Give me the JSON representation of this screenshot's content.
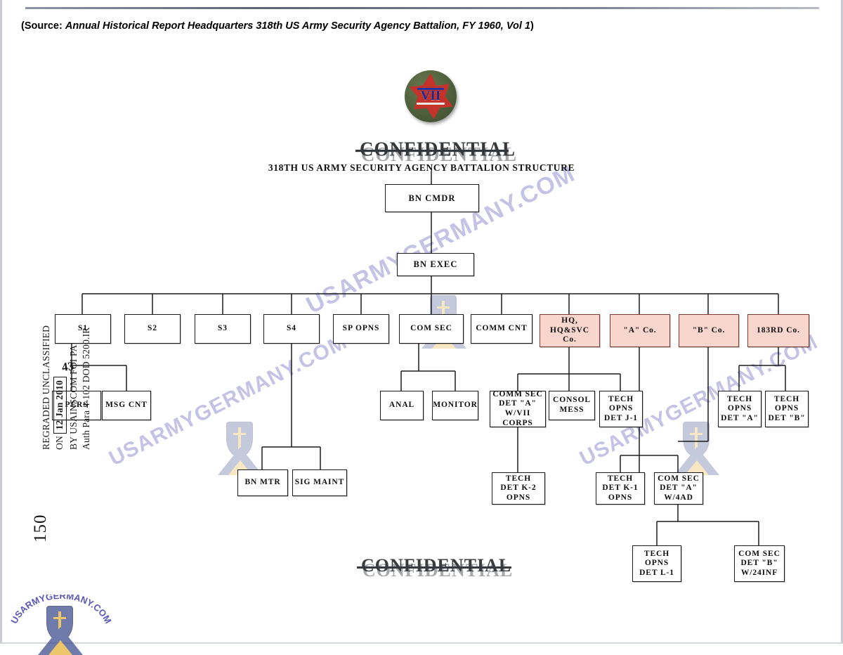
{
  "document": {
    "source_line_prefix": "(Source: ",
    "source_line_italic": "Annual Historical Report Headquarters 318th US Army Security Agency Battalion, FY 1960, Vol 1",
    "source_line_suffix": ")",
    "page_number": "150",
    "chart_title": "318TH US ARMY SECURITY AGENCY BATTALION STRUCTURE",
    "classification_top": "CONFIDENTIAL",
    "classification_bottom": "CONFIDENTIAL",
    "handwritten_note": "43"
  },
  "insignia": {
    "name": "vii-corps-patch",
    "numerals": "VII",
    "star_color": "#c4322c",
    "field_color": "#4e5f3c",
    "numeral_color": "#1a2a8c"
  },
  "declassification_stamp": {
    "line1": "REGRADED UNCLASSIFIED",
    "line2_label": "ON",
    "line2_date": "12 Jan 2010",
    "line3": "BY USAINSCOM FOI PA",
    "line4": "Auth Para 4-102 DOD 5200.IR"
  },
  "watermarks": {
    "text": "USARMYGERMANY.COM",
    "color": "#6c68be"
  },
  "chart_data": {
    "type": "diagram",
    "title": "318TH US ARMY SECURITY AGENCY BATTALION STRUCTURE",
    "diagram_kind": "organizational-chart",
    "highlight_color": "#f8d5cd",
    "nodes": [
      {
        "id": "bn_cmdr",
        "label": "BN  CMDR",
        "tier": 0,
        "highlight": false
      },
      {
        "id": "bn_exec",
        "label": "BN  EXEC",
        "tier": 1,
        "highlight": false
      },
      {
        "id": "s1",
        "label": "S1",
        "tier": 2,
        "highlight": false
      },
      {
        "id": "s2",
        "label": "S2",
        "tier": 2,
        "highlight": false
      },
      {
        "id": "s3",
        "label": "S3",
        "tier": 2,
        "highlight": false
      },
      {
        "id": "s4",
        "label": "S4",
        "tier": 2,
        "highlight": false
      },
      {
        "id": "sp_opns",
        "label": "SP OPNS",
        "tier": 2,
        "highlight": false
      },
      {
        "id": "com_sec",
        "label": "COM SEC",
        "tier": 2,
        "highlight": false
      },
      {
        "id": "comm_cnt",
        "label": "COMM CNT",
        "tier": 2,
        "highlight": false
      },
      {
        "id": "hq_svc_co",
        "label": "HQ, HQ&SVC\nCo.",
        "tier": 2,
        "highlight": true
      },
      {
        "id": "a_co",
        "label": "\"A\" Co.",
        "tier": 2,
        "highlight": true
      },
      {
        "id": "b_co",
        "label": "\"B\" Co.",
        "tier": 2,
        "highlight": true
      },
      {
        "id": "co_183rd",
        "label": "183RD Co.",
        "tier": 2,
        "highlight": true
      },
      {
        "id": "pers",
        "label": "PERS",
        "tier": 3,
        "highlight": false
      },
      {
        "id": "msg_cnt",
        "label": "MSG CNT",
        "tier": 3,
        "highlight": false
      },
      {
        "id": "anal",
        "label": "ANAL",
        "tier": 3,
        "highlight": false
      },
      {
        "id": "monitor",
        "label": "MONITOR",
        "tier": 3,
        "highlight": false
      },
      {
        "id": "comm_sec_det_a",
        "label": "COMM SEC\nDET \"A\"\nW/VII CORPS",
        "tier": 3,
        "highlight": false
      },
      {
        "id": "consol_mess",
        "label": "CONSOL\nMESS",
        "tier": 3,
        "highlight": false
      },
      {
        "id": "tech_opns_j1",
        "label": "TECH\nOPNS\nDET J-1",
        "tier": 3,
        "highlight": false
      },
      {
        "id": "tech_opns_det_a",
        "label": "TECH\nOPNS\nDET \"A\"",
        "tier": 3,
        "highlight": false
      },
      {
        "id": "tech_opns_det_b",
        "label": "TECH\nOPNS\nDET \"B\"",
        "tier": 3,
        "highlight": false
      },
      {
        "id": "bn_mtr",
        "label": "BN MTR",
        "tier": 4,
        "highlight": false
      },
      {
        "id": "sig_maint",
        "label": "SIG MAINT",
        "tier": 4,
        "highlight": false
      },
      {
        "id": "tech_det_k2",
        "label": "TECH\nDET K-2\nOPNS",
        "tier": 4,
        "highlight": false
      },
      {
        "id": "tech_det_k1",
        "label": "TECH\nDET K-1\nOPNS",
        "tier": 4,
        "highlight": false
      },
      {
        "id": "com_sec_det_a_4ad",
        "label": "COM SEC\nDET \"A\"\nW/4AD",
        "tier": 4,
        "highlight": false
      },
      {
        "id": "tech_opns_l1",
        "label": "TECH\nOPNS\nDET L-1",
        "tier": 5,
        "highlight": false
      },
      {
        "id": "com_sec_det_b_24inf",
        "label": "COM SEC\nDET \"B\"\nW/24INF",
        "tier": 5,
        "highlight": false
      }
    ],
    "edges": [
      [
        "bn_cmdr",
        "bn_exec"
      ],
      [
        "bn_exec",
        "s1"
      ],
      [
        "bn_exec",
        "s2"
      ],
      [
        "bn_exec",
        "s3"
      ],
      [
        "bn_exec",
        "s4"
      ],
      [
        "bn_exec",
        "sp_opns"
      ],
      [
        "bn_exec",
        "com_sec"
      ],
      [
        "bn_exec",
        "comm_cnt"
      ],
      [
        "bn_exec",
        "hq_svc_co"
      ],
      [
        "bn_exec",
        "a_co"
      ],
      [
        "bn_exec",
        "b_co"
      ],
      [
        "bn_exec",
        "co_183rd"
      ],
      [
        "s1",
        "pers"
      ],
      [
        "s1",
        "msg_cnt"
      ],
      [
        "com_sec",
        "anal"
      ],
      [
        "com_sec",
        "monitor"
      ],
      [
        "hq_svc_co",
        "comm_sec_det_a"
      ],
      [
        "hq_svc_co",
        "consol_mess"
      ],
      [
        "hq_svc_co",
        "tech_opns_j1"
      ],
      [
        "co_183rd",
        "tech_opns_det_a"
      ],
      [
        "co_183rd",
        "tech_opns_det_b"
      ],
      [
        "s4",
        "bn_mtr"
      ],
      [
        "s4",
        "sig_maint"
      ],
      [
        "comm_sec_det_a",
        "tech_det_k2"
      ],
      [
        "a_co",
        "tech_det_k1"
      ],
      [
        "a_co",
        "com_sec_det_a_4ad"
      ],
      [
        "b_co",
        "com_sec_det_a_4ad"
      ],
      [
        "com_sec_det_a_4ad",
        "tech_opns_l1"
      ],
      [
        "com_sec_det_a_4ad",
        "com_sec_det_b_24inf"
      ]
    ]
  }
}
